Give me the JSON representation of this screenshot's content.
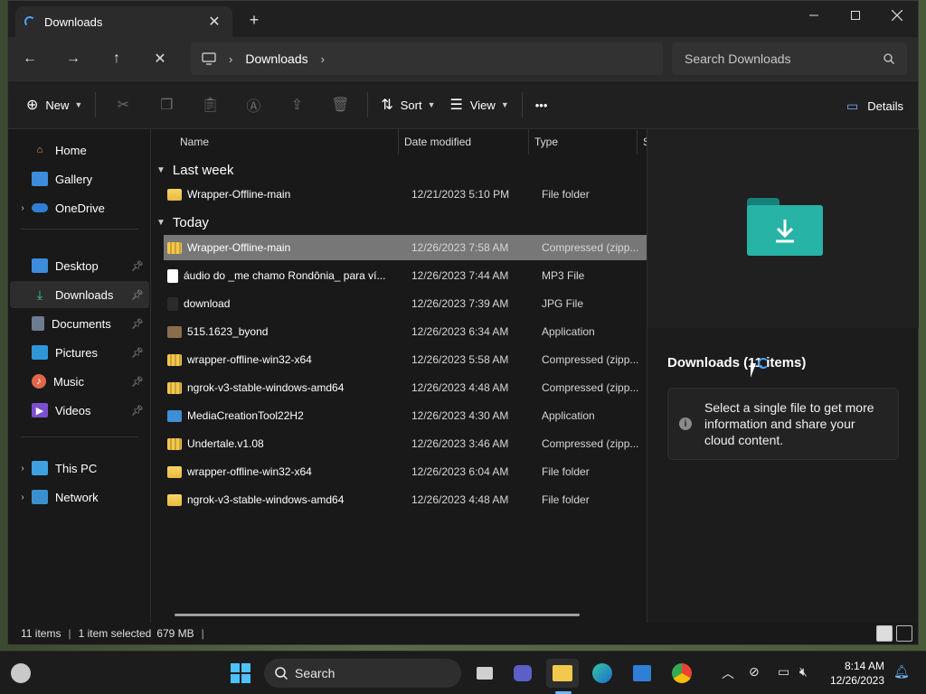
{
  "window": {
    "tab_title": "Downloads",
    "tab_close": "✕",
    "new_tab": "+"
  },
  "nav": {
    "back": "←",
    "forward": "→",
    "up": "↑",
    "stop": "✕",
    "address": {
      "pc_icon": "monitor-icon",
      "crumb": "Downloads",
      "sep": "›"
    },
    "search_placeholder": "Search Downloads"
  },
  "toolbar": {
    "new_label": "New",
    "sort_label": "Sort",
    "view_label": "View",
    "more": "•••",
    "details_label": "Details"
  },
  "sidebar": {
    "home": "Home",
    "gallery": "Gallery",
    "onedrive": "OneDrive",
    "desktop": "Desktop",
    "downloads": "Downloads",
    "documents": "Documents",
    "pictures": "Pictures",
    "music": "Music",
    "videos": "Videos",
    "thispc": "This PC",
    "network": "Network"
  },
  "columns": {
    "name": "Name",
    "date": "Date modified",
    "type": "Type",
    "size": "S"
  },
  "groups": {
    "last_week": "Last week",
    "today": "Today"
  },
  "files_last_week": [
    {
      "name": "Wrapper-Offline-main",
      "date": "12/21/2023 5:10 PM",
      "type": "File folder"
    }
  ],
  "files_today": [
    {
      "name": "Wrapper-Offline-main",
      "date": "12/26/2023 7:58 AM",
      "type": "Compressed (zipp..."
    },
    {
      "name": "áudio do _me chamo Rondônia_ para ví...",
      "date": "12/26/2023 7:44 AM",
      "type": "MP3 File"
    },
    {
      "name": "download",
      "date": "12/26/2023 7:39 AM",
      "type": "JPG File"
    },
    {
      "name": "515.1623_byond",
      "date": "12/26/2023 6:34 AM",
      "type": "Application"
    },
    {
      "name": "wrapper-offline-win32-x64",
      "date": "12/26/2023 5:58 AM",
      "type": "Compressed (zipp..."
    },
    {
      "name": "ngrok-v3-stable-windows-amd64",
      "date": "12/26/2023 4:48 AM",
      "type": "Compressed (zipp..."
    },
    {
      "name": "MediaCreationTool22H2",
      "date": "12/26/2023 4:30 AM",
      "type": "Application"
    },
    {
      "name": "Undertale.v1.08",
      "date": "12/26/2023 3:46 AM",
      "type": "Compressed (zipp..."
    },
    {
      "name": "wrapper-offline-win32-x64",
      "date": "12/26/2023 6:04 AM",
      "type": "File folder"
    },
    {
      "name": "ngrok-v3-stable-windows-amd64",
      "date": "12/26/2023 4:48 AM",
      "type": "File folder"
    }
  ],
  "details": {
    "title": "Downloads (11 items)",
    "info": "Select a single file to get more information and share your cloud content."
  },
  "status": {
    "items": "11 items",
    "selected": "1 item selected",
    "size": "679 MB"
  },
  "taskbar": {
    "search_label": "Search",
    "time": "8:14 AM",
    "date": "12/26/2023"
  },
  "colors": {
    "accent": "#4aa3ff",
    "selected_row": "#777777",
    "folder": "#f2c94c",
    "downloads_folder": "#27b3a6"
  }
}
